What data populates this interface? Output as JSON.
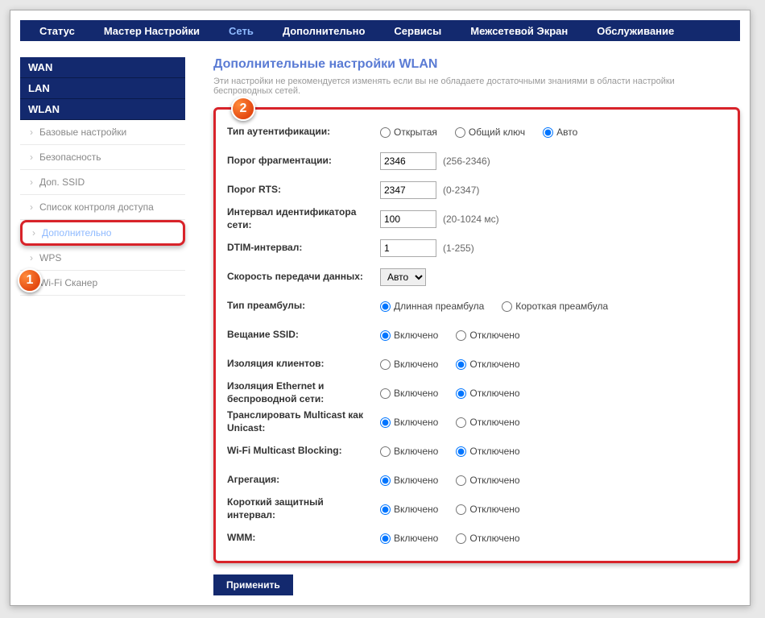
{
  "topnav": [
    {
      "id": "status",
      "label": "Статус"
    },
    {
      "id": "wizard",
      "label": "Мастер Настройки"
    },
    {
      "id": "network",
      "label": "Сеть",
      "active": true
    },
    {
      "id": "advanced",
      "label": "Дополнительно"
    },
    {
      "id": "services",
      "label": "Сервисы"
    },
    {
      "id": "firewall",
      "label": "Межсетевой Экран"
    },
    {
      "id": "maintenance",
      "label": "Обслуживание"
    }
  ],
  "sidebar": {
    "sections": [
      {
        "id": "wan",
        "label": "WAN"
      },
      {
        "id": "lan",
        "label": "LAN"
      },
      {
        "id": "wlan",
        "label": "WLAN",
        "active": true
      }
    ],
    "sub": [
      {
        "id": "basic",
        "label": "Базовые настройки"
      },
      {
        "id": "security",
        "label": "Безопасность"
      },
      {
        "id": "ssid",
        "label": "Доп. SSID"
      },
      {
        "id": "acl",
        "label": "Список контроля доступа"
      },
      {
        "id": "adv",
        "label": "Дополнительно",
        "current": true
      },
      {
        "id": "wps",
        "label": "WPS"
      },
      {
        "id": "wifiscan",
        "label": "Wi-Fi Сканер"
      }
    ]
  },
  "title": "Дополнительные настройки WLAN",
  "description": "Эти настройки не рекомендуется изменять если вы не обладаете достаточными знаниями в области настройки беспроводных сетей.",
  "fields": {
    "auth_type": {
      "label": "Тип аутентификации:",
      "options": [
        "Открытая",
        "Общий ключ",
        "Авто"
      ],
      "value": "Авто"
    },
    "frag_threshold": {
      "label": "Порог фрагментации:",
      "value": "2346",
      "hint": "(256-2346)"
    },
    "rts_threshold": {
      "label": "Порог RTS:",
      "value": "2347",
      "hint": "(0-2347)"
    },
    "beacon_interval": {
      "label": "Интервал идентификатора сети:",
      "value": "100",
      "hint": "(20-1024 мс)"
    },
    "dtim": {
      "label": "DTIM-интервал:",
      "value": "1",
      "hint": "(1-255)"
    },
    "data_rate": {
      "label": "Скорость передачи данных:",
      "value": "Авто"
    },
    "preamble": {
      "label": "Тип преамбулы:",
      "options": [
        "Длинная преамбула",
        "Короткая преамбула"
      ],
      "value": "Длинная преамбула"
    },
    "ssid_broadcast": {
      "label": "Вещание SSID:",
      "options": [
        "Включено",
        "Отключено"
      ],
      "value": "Включено"
    },
    "client_isolation": {
      "label": "Изоляция клиентов:",
      "options": [
        "Включено",
        "Отключено"
      ],
      "value": "Отключено"
    },
    "eth_wlan_isolation": {
      "label": "Изоляция Ethernet и беспроводной сети:",
      "options": [
        "Включено",
        "Отключено"
      ],
      "value": "Отключено"
    },
    "multicast2unicast": {
      "label": "Транслировать Multicast как Unicast:",
      "options": [
        "Включено",
        "Отключено"
      ],
      "value": "Включено"
    },
    "wifi_mcast_block": {
      "label": "Wi-Fi Multicast Blocking:",
      "options": [
        "Включено",
        "Отключено"
      ],
      "value": "Отключено"
    },
    "aggregation": {
      "label": "Агрегация:",
      "options": [
        "Включено",
        "Отключено"
      ],
      "value": "Включено"
    },
    "short_gi": {
      "label": "Короткий защитный интервал:",
      "options": [
        "Включено",
        "Отключено"
      ],
      "value": "Включено"
    },
    "wmm": {
      "label": "WMM:",
      "options": [
        "Включено",
        "Отключено"
      ],
      "value": "Включено"
    }
  },
  "apply_label": "Применить",
  "callouts": {
    "1": "1",
    "2": "2"
  }
}
